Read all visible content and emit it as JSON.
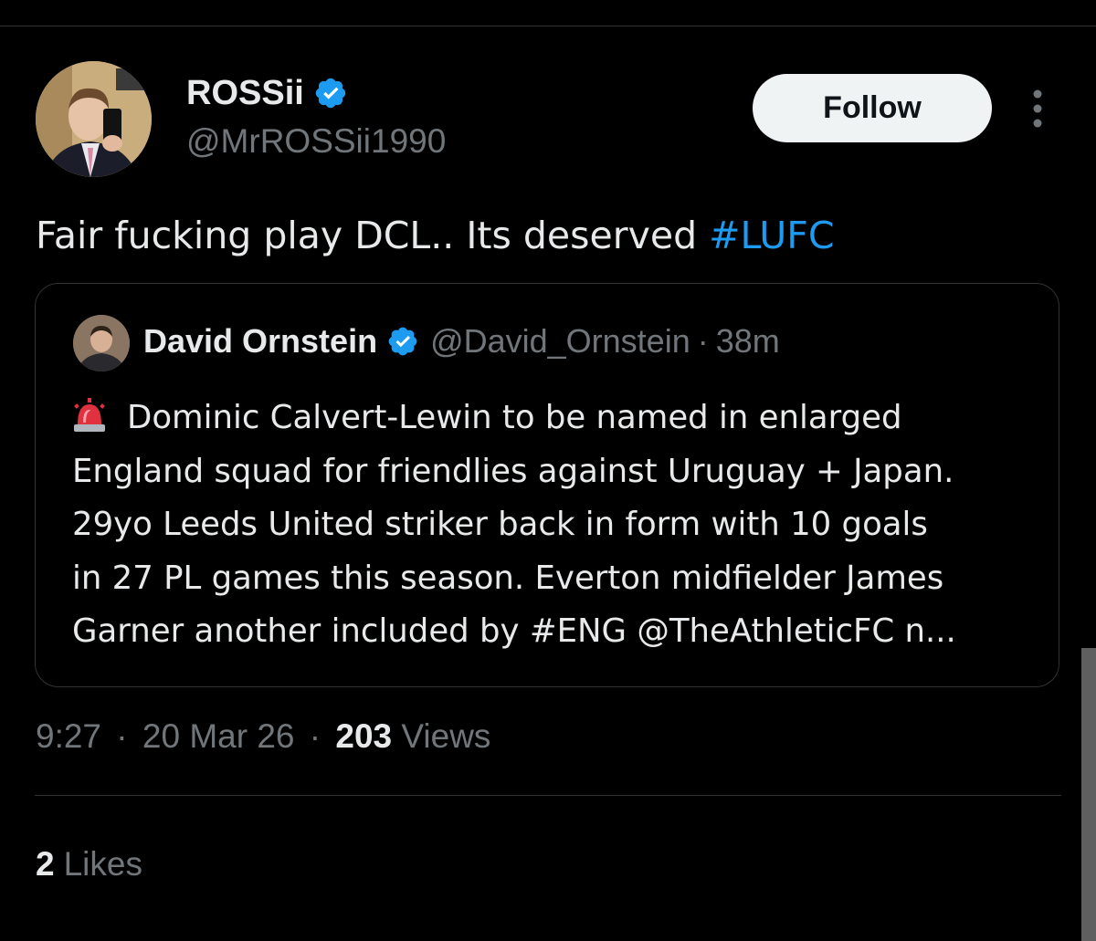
{
  "author": {
    "name": "ROSSii",
    "handle": "@MrROSSii1990",
    "verified": true,
    "avatar": "person-holding-phone-mirror-selfie"
  },
  "follow_button": {
    "label": "Follow"
  },
  "more_icon": "more-vertical-icon",
  "tweet": {
    "text": "Fair fucking play DCL.. Its deserved ",
    "hashtag": "#LUFC"
  },
  "quoted_tweet": {
    "author_name": "David Ornstein",
    "handle": "@David_Ornstein",
    "separator": "·",
    "time": "38m",
    "verified": true,
    "emoji": "police-siren-emoji",
    "lines": [
      "Dominic Calvert-Lewin to be named in enlarged",
      "England squad for friendlies against Uruguay + Japan.",
      "29yo Leeds United striker back in form with 10 goals",
      "in 27 PL games this season. Everton midfielder James",
      "Garner another included by #ENG @TheAthleticFC n..."
    ]
  },
  "meta": {
    "time": "9:27",
    "separator": "·",
    "date": "20 Mar 26",
    "views_count": "203",
    "views_label": "Views"
  },
  "likes": {
    "count": "2",
    "label": "Likes"
  },
  "colors": {
    "background": "#000000",
    "text": "#e7e9ea",
    "secondary": "#71767b",
    "accent": "#1d9bf0",
    "border": "#2f3336",
    "follow_bg": "#eff3f4"
  }
}
